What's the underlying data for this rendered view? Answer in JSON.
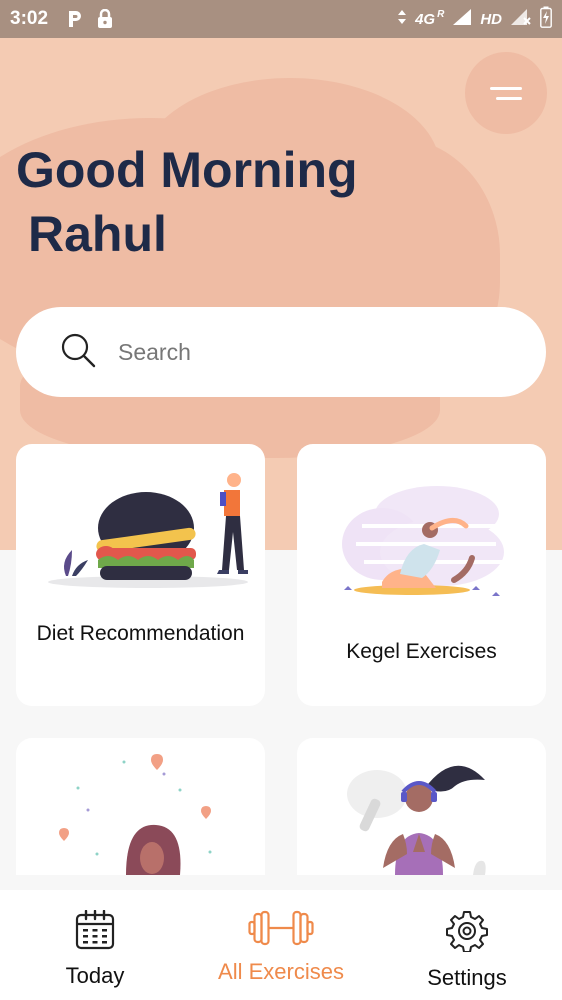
{
  "status_bar": {
    "time": "3:02",
    "network": "4G",
    "roaming": "R",
    "hd": "HD"
  },
  "header": {
    "greeting": "Good Morning",
    "user_name": "Rahul"
  },
  "search": {
    "placeholder": "Search"
  },
  "cards": [
    {
      "title": "Diet Recommendation"
    },
    {
      "title": "Kegel Exercises"
    }
  ],
  "bottom_nav": {
    "items": [
      {
        "label": "Today",
        "icon": "calendar-icon"
      },
      {
        "label": "All Exercises",
        "icon": "dumbbell-icon",
        "active": true
      },
      {
        "label": "Settings",
        "icon": "gear-icon"
      }
    ]
  },
  "colors": {
    "hero_bg": "#f4cbb3",
    "accent": "#ef8a4b",
    "heading": "#1e2a48"
  }
}
